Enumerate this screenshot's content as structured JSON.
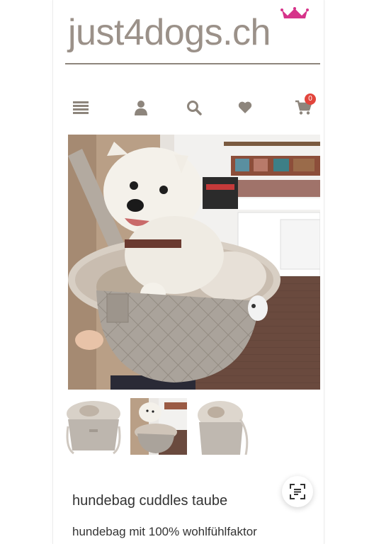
{
  "brand": {
    "logo_text": "just4dogs.ch",
    "crown_color": "#d6338a",
    "text_color": "#9b9189"
  },
  "nav": {
    "items": [
      {
        "icon": "menu-icon"
      },
      {
        "icon": "user-icon"
      },
      {
        "icon": "search-icon"
      },
      {
        "icon": "heart-icon"
      },
      {
        "icon": "cart-icon",
        "badge": "0"
      }
    ],
    "icon_color": "#8d857c",
    "badge_color": "#e2453c"
  },
  "product": {
    "title": "hundebag cuddles taube",
    "subtitle": "hundebag mit 100% wohlfühlfaktor"
  },
  "gallery": {
    "thumbnails": [
      "bag-front-thumbnail",
      "dog-in-bag-thumbnail",
      "bag-side-thumbnail"
    ],
    "selected": 1
  },
  "overlay": {
    "icon": "scan-text-icon"
  }
}
